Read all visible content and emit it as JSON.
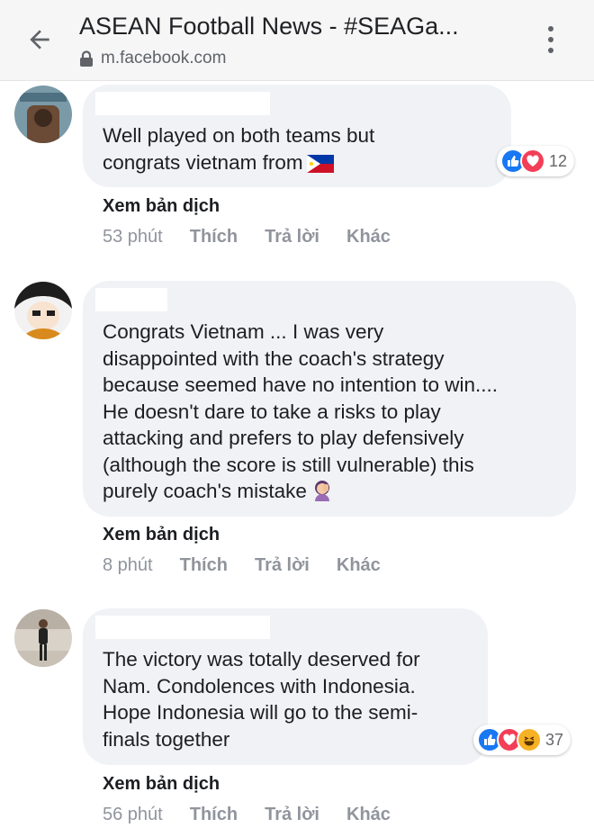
{
  "browser": {
    "title": "ASEAN Football News - #SEAGa...",
    "url": "m.facebook.com"
  },
  "comments": [
    {
      "text": "Well played on both teams but\ncongrats vietnam from",
      "emoji": "philippines-flag",
      "reactions": {
        "icons": [
          "like",
          "love"
        ],
        "count": "12"
      },
      "translate": "Xem bản dịch",
      "time": "53 phút",
      "like": "Thích",
      "reply": "Trả lời",
      "more": "Khác"
    },
    {
      "text": "Congrats Vietnam ... I was very\ndisappointed with the coach's strategy\nbecause seemed have no intention to win....\nHe doesn't dare to take a risks to play\nattacking and prefers to play defensively\n(although the score is still vulnerable) this\npurely coach's mistake",
      "emoji": "facepalm",
      "translate": "Xem bản dịch",
      "time": "8 phút",
      "like": "Thích",
      "reply": "Trả lời",
      "more": "Khác"
    },
    {
      "text": "The victory was totally deserved for\nNam. Condolences with Indonesia.\nHope Indonesia will go to the semi-\nfinals together",
      "reactions": {
        "icons": [
          "like",
          "love",
          "haha"
        ],
        "count": "37"
      },
      "translate": "Xem bản dịch",
      "time": "56 phút",
      "like": "Thích",
      "reply": "Trả lời",
      "more": "Khác"
    }
  ],
  "colors": {
    "bubble": "#f0f2f5",
    "like": "#1877f2",
    "love": "#f33e58",
    "haha": "#f7b125",
    "meta": "#90949c"
  }
}
